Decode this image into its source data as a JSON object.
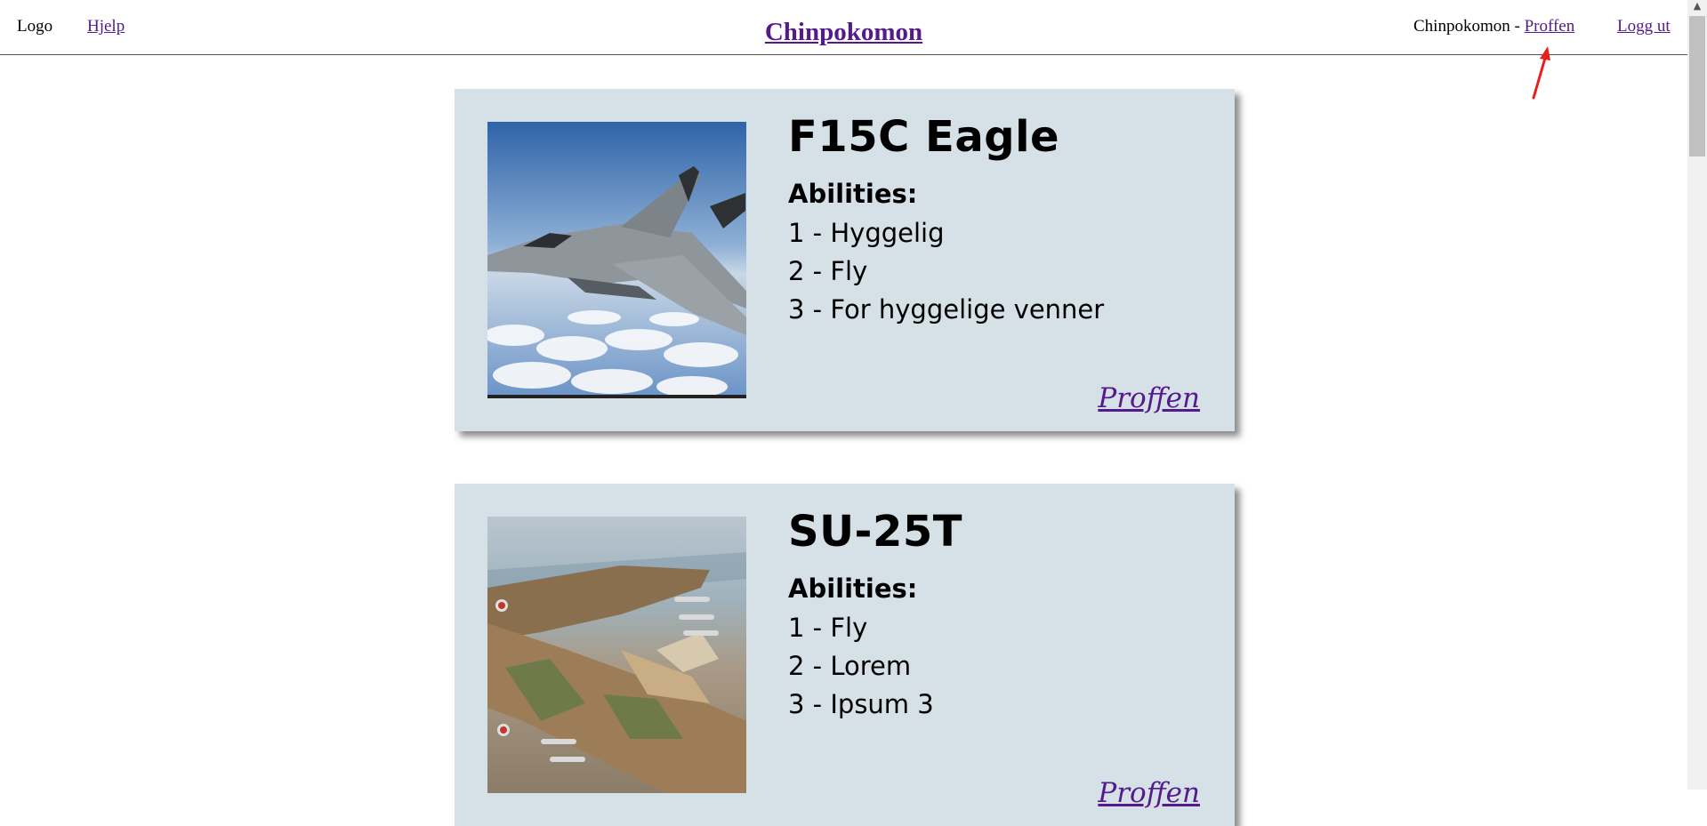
{
  "header": {
    "logo": "Logo",
    "help_link": "Hjelp",
    "title": "Chinpokomon",
    "user_prefix": "Chinpokomon - ",
    "user_name": "Proffen",
    "logout": "Logg ut"
  },
  "cards": [
    {
      "title": "F15C Eagle",
      "abilities_heading": "Abilities:",
      "abilities": [
        "1 - Hyggelig",
        "2 - Fly",
        "3 - For hyggelige venner"
      ],
      "owner": "Proffen"
    },
    {
      "title": "SU-25T",
      "abilities_heading": "Abilities:",
      "abilities": [
        "1 - Fly",
        "2 - Lorem",
        "3 - Ipsum 3"
      ],
      "owner": "Proffen"
    }
  ],
  "annotation": {
    "arrow_color": "#e8201c"
  },
  "colors": {
    "link": "#551a8b",
    "card_background": "#d5e0e7"
  }
}
